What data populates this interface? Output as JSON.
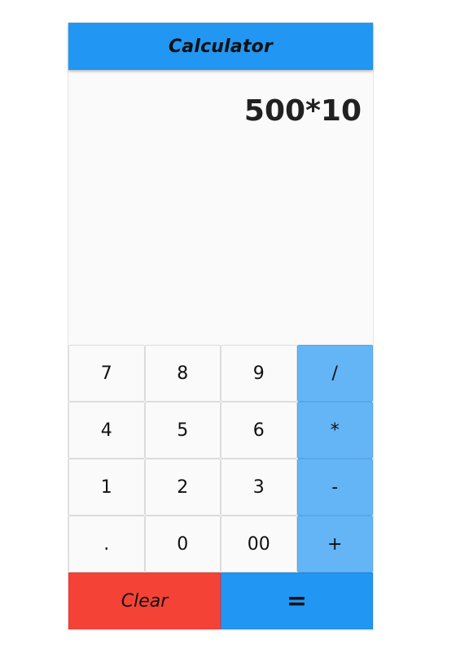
{
  "app": {
    "title": "Calculator"
  },
  "display": {
    "expression": "500*10"
  },
  "keypad": {
    "rows": [
      [
        {
          "label": "7",
          "type": "digit"
        },
        {
          "label": "8",
          "type": "digit"
        },
        {
          "label": "9",
          "type": "digit"
        },
        {
          "label": "/",
          "type": "operator"
        }
      ],
      [
        {
          "label": "4",
          "type": "digit"
        },
        {
          "label": "5",
          "type": "digit"
        },
        {
          "label": "6",
          "type": "digit"
        },
        {
          "label": "*",
          "type": "operator"
        }
      ],
      [
        {
          "label": "1",
          "type": "digit"
        },
        {
          "label": "2",
          "type": "digit"
        },
        {
          "label": "3",
          "type": "digit"
        },
        {
          "label": "-",
          "type": "operator"
        }
      ],
      [
        {
          "label": ".",
          "type": "digit"
        },
        {
          "label": "0",
          "type": "digit"
        },
        {
          "label": "00",
          "type": "digit"
        },
        {
          "label": "+",
          "type": "operator"
        }
      ]
    ]
  },
  "actions": {
    "clear_label": "Clear",
    "equals_label": "="
  },
  "colors": {
    "app_bar": "#2196f3",
    "operator_key": "#64b5f6",
    "clear_button": "#f44336",
    "equals_button": "#2196f3",
    "display_background": "#fafafa"
  }
}
